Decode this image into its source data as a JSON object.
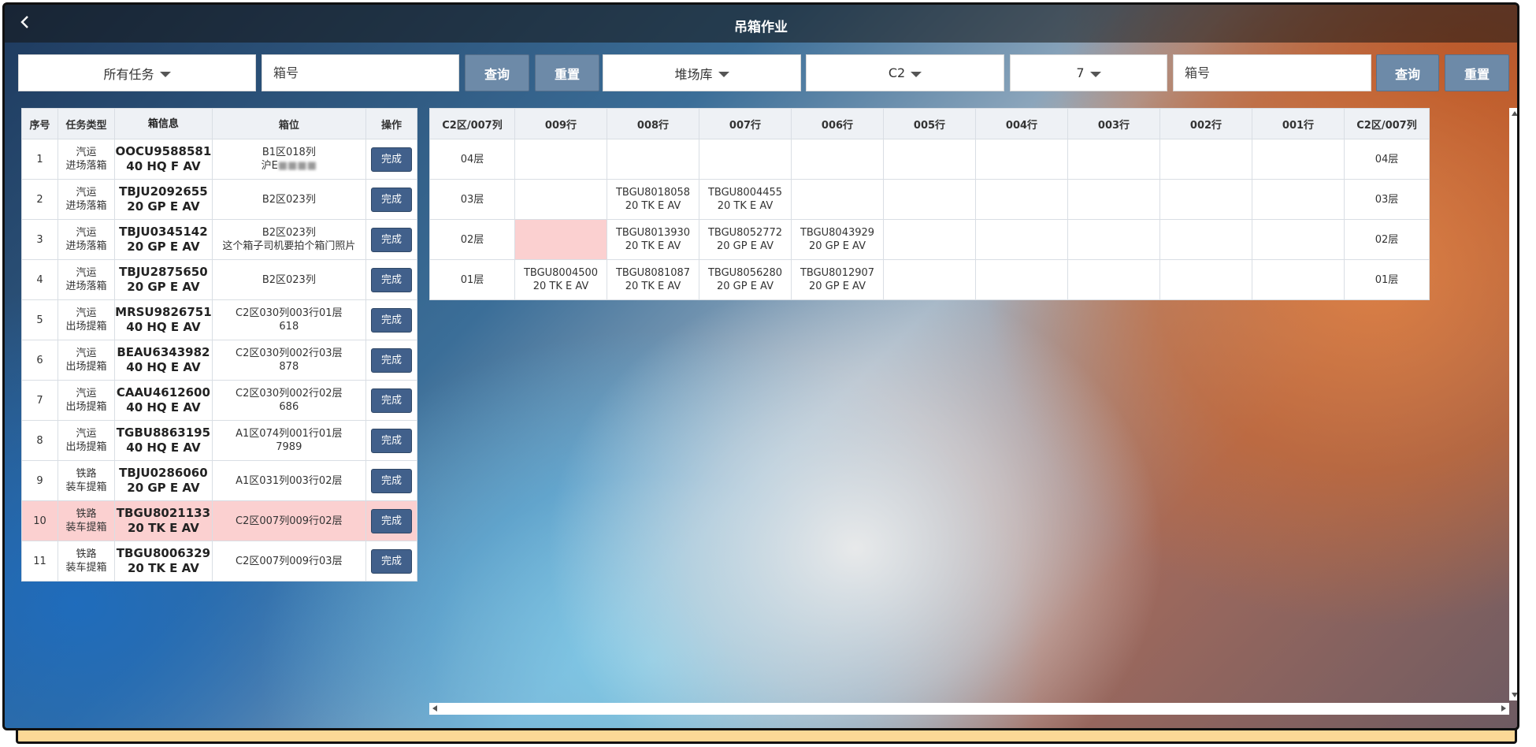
{
  "header": {
    "title": "吊箱作业"
  },
  "filters": {
    "task_filter": "所有任务",
    "box_no_placeholder_left": "箱号",
    "query_label": "查询",
    "reset_label": "重置",
    "yard_select": "堆场库",
    "zone_select": "C2",
    "column_select": "7",
    "box_no_placeholder_right": "箱号"
  },
  "task_table": {
    "headers": [
      "序号",
      "任务类型",
      "箱信息",
      "箱位",
      "操作"
    ],
    "rows": [
      {
        "idx": "1",
        "type1": "汽运",
        "type2": "进场落箱",
        "box1": "OOCU9588581",
        "box2": "40 HQ F AV",
        "loc1": "B1区018列",
        "loc2": "沪E",
        "loc2_blur": "■■■■",
        "op": "完成"
      },
      {
        "idx": "2",
        "type1": "汽运",
        "type2": "进场落箱",
        "box1": "TBJU2092655",
        "box2": "20 GP E AV",
        "loc1": "B2区023列",
        "loc2": "",
        "op": "完成"
      },
      {
        "idx": "3",
        "type1": "汽运",
        "type2": "进场落箱",
        "box1": "TBJU0345142",
        "box2": "20 GP E AV",
        "loc1": "B2区023列",
        "loc2": "这个箱子司机要拍个箱门照片",
        "op": "完成"
      },
      {
        "idx": "4",
        "type1": "汽运",
        "type2": "进场落箱",
        "box1": "TBJU2875650",
        "box2": "20 GP E AV",
        "loc1": "B2区023列",
        "loc2": "",
        "op": "完成"
      },
      {
        "idx": "5",
        "type1": "汽运",
        "type2": "出场提箱",
        "box1": "MRSU9826751",
        "box2": "40 HQ E AV",
        "loc1": "C2区030列003行01层",
        "loc2": "618",
        "op": "完成"
      },
      {
        "idx": "6",
        "type1": "汽运",
        "type2": "出场提箱",
        "box1": "BEAU6343982",
        "box2": "40 HQ E AV",
        "loc1": "C2区030列002行03层",
        "loc2": "878",
        "op": "完成"
      },
      {
        "idx": "7",
        "type1": "汽运",
        "type2": "出场提箱",
        "box1": "CAAU4612600",
        "box2": "40 HQ E AV",
        "loc1": "C2区030列002行02层",
        "loc2": "686",
        "op": "完成"
      },
      {
        "idx": "8",
        "type1": "汽运",
        "type2": "出场提箱",
        "box1": "TGBU8863195",
        "box2": "40 HQ E AV",
        "loc1": "A1区074列001行01层",
        "loc2": "7989",
        "op": "完成"
      },
      {
        "idx": "9",
        "type1": "铁路",
        "type2": "装车提箱",
        "box1": "TBJU0286060",
        "box2": "20 GP E AV",
        "loc1": "A1区031列003行02层",
        "loc2": "",
        "op": "完成"
      },
      {
        "idx": "10",
        "type1": "铁路",
        "type2": "装车提箱",
        "box1": "TBGU8021133",
        "box2": "20 TK E AV",
        "loc1": "C2区007列009行02层",
        "loc2": "",
        "op": "完成",
        "highlight": true
      },
      {
        "idx": "11",
        "type1": "铁路",
        "type2": "装车提箱",
        "box1": "TBGU8006329",
        "box2": "20 TK E AV",
        "loc1": "C2区007列009行03层",
        "loc2": "",
        "op": "完成"
      }
    ]
  },
  "yard_grid": {
    "headers": [
      "C2区/007列",
      "009行",
      "008行",
      "007行",
      "006行",
      "005行",
      "004行",
      "003行",
      "002行",
      "001行",
      "C2区/007列"
    ],
    "rows": [
      {
        "tier": "04层",
        "cells": [
          [
            "",
            ""
          ],
          [
            "",
            ""
          ],
          [
            "",
            ""
          ],
          [
            "",
            ""
          ],
          [
            "",
            ""
          ],
          [
            "",
            ""
          ],
          [
            "",
            ""
          ],
          [
            "",
            ""
          ],
          [
            "",
            ""
          ]
        ],
        "tier_right": "04层"
      },
      {
        "tier": "03层",
        "cells": [
          [
            "",
            ""
          ],
          [
            "TBGU8018058",
            "20 TK E AV"
          ],
          [
            "TBGU8004455",
            "20 TK E AV"
          ],
          [
            "",
            ""
          ],
          [
            "",
            ""
          ],
          [
            "",
            ""
          ],
          [
            "",
            ""
          ],
          [
            "",
            ""
          ],
          [
            "",
            ""
          ]
        ],
        "tier_right": "03层"
      },
      {
        "tier": "02层",
        "cells": [
          [
            "",
            ""
          ],
          [
            "TBGU8013930",
            "20 TK E AV"
          ],
          [
            "TBGU8052772",
            "20 GP E AV"
          ],
          [
            "TBGU8043929",
            "20 GP E AV"
          ],
          [
            "",
            ""
          ],
          [
            "",
            ""
          ],
          [
            "",
            ""
          ],
          [
            "",
            ""
          ],
          [
            "",
            ""
          ]
        ],
        "tier_right": "02层",
        "red_cell": 0
      },
      {
        "tier": "01层",
        "cells": [
          [
            "TBGU8004500",
            "20 TK E AV"
          ],
          [
            "TBGU8081087",
            "20 TK E AV"
          ],
          [
            "TBGU8056280",
            "20 GP E AV"
          ],
          [
            "TBGU8012907",
            "20 GP E AV"
          ],
          [
            "",
            ""
          ],
          [
            "",
            ""
          ],
          [
            "",
            ""
          ],
          [
            "",
            ""
          ],
          [
            "",
            ""
          ]
        ],
        "tier_right": "01层"
      }
    ]
  },
  "colors": {
    "button": "#6d8aa8",
    "done_button": "#41608b",
    "highlight_row": "#fbd0d0"
  },
  "icons": {
    "back": "chevron-left-icon",
    "dropdown": "caret-down-icon"
  }
}
